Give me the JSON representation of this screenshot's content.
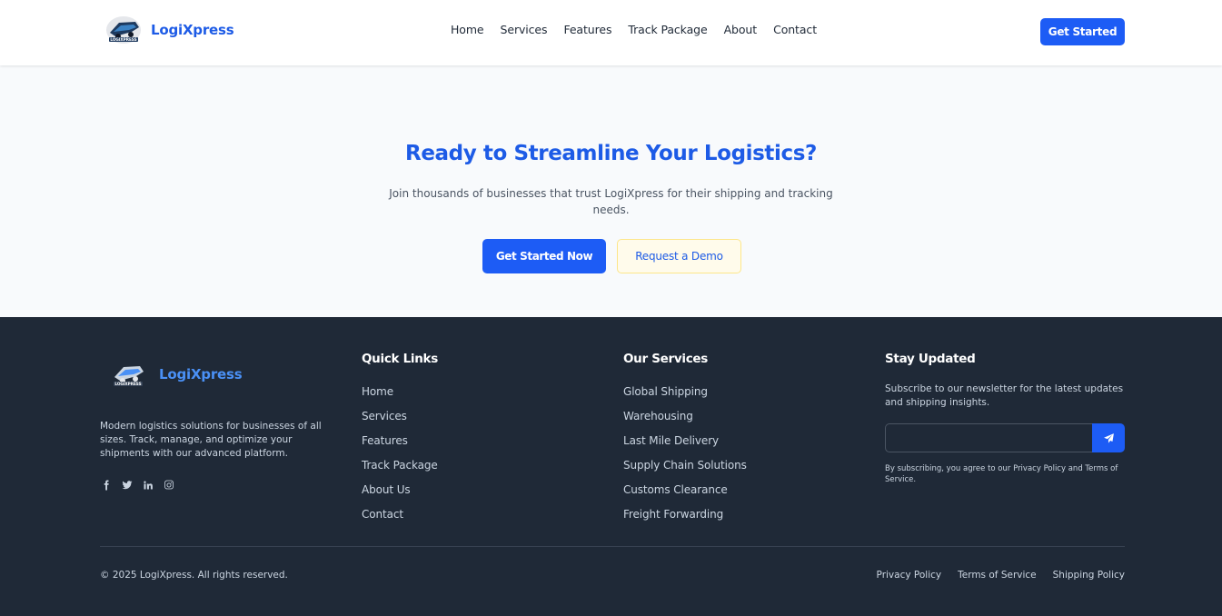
{
  "header": {
    "brand": "LogiXpress",
    "nav": [
      "Home",
      "Services",
      "Features",
      "Track Package",
      "About",
      "Contact"
    ],
    "cta_label": "Get Started"
  },
  "cta": {
    "title": "Ready to Streamline Your Logistics?",
    "subtitle": "Join thousands of businesses that trust LogiXpress for their shipping and tracking needs.",
    "primary_label": "Get Started Now",
    "secondary_label": "Request a Demo"
  },
  "footer": {
    "brand": "LogiXpress",
    "description": "Modern logistics solutions for businesses of all sizes. Track, manage, and optimize your shipments with our advanced platform.",
    "socials": [
      "facebook-icon",
      "twitter-icon",
      "linkedin-icon",
      "instagram-icon"
    ],
    "quick_links": {
      "title": "Quick Links",
      "items": [
        "Home",
        "Services",
        "Features",
        "Track Package",
        "About Us",
        "Contact"
      ]
    },
    "services": {
      "title": "Our Services",
      "items": [
        "Global Shipping",
        "Warehousing",
        "Last Mile Delivery",
        "Supply Chain Solutions",
        "Customs Clearance",
        "Freight Forwarding"
      ]
    },
    "newsletter": {
      "title": "Stay Updated",
      "text": "Subscribe to our newsletter for the latest updates and shipping insights.",
      "input_value": "",
      "note": "By subscribing, you agree to our Privacy Policy and Terms of Service."
    },
    "copyright": "© 2025 LogiXpress. All rights reserved.",
    "legal": [
      "Privacy Policy",
      "Terms of Service",
      "Shipping Policy"
    ]
  },
  "colors": {
    "brand_blue": "#1d5cf5",
    "footer_bg": "#1f2937",
    "cta_bg": "#f8fafc"
  }
}
